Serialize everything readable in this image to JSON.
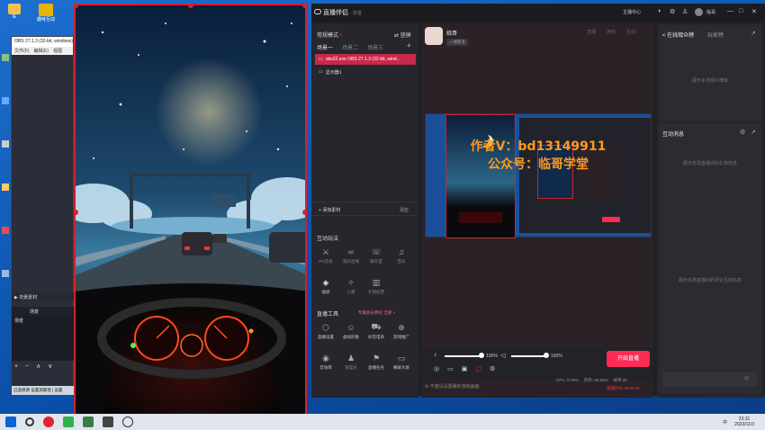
{
  "desktop": {
    "icons": [
      {
        "label": "IE",
        "color": "#f2c14e"
      },
      {
        "label": "趣味互动",
        "color": "#e8b400"
      }
    ]
  },
  "obs": {
    "title": "OBS 27.1.3 (32-bit, windows)",
    "menu": [
      "文件(F)",
      "编辑(E)",
      "视图"
    ],
    "panels": {
      "sources_label": "背景素材",
      "scenes_header": "场景",
      "scenes_item": "场景",
      "controls_label": "+ − ∧ ∨"
    },
    "status": [
      "已选择源",
      "设置源属性 | 设置"
    ]
  },
  "app": {
    "title": "直播伴侣",
    "subtitle": "· 抖音",
    "window_controls": [
      "主播中心",
      "临哥",
      "—",
      "□",
      "✕"
    ],
    "mode_label": "常规模式",
    "mode_toggle": "竖屏",
    "scene_tabs": [
      "场景一",
      "场景二",
      "场景三"
    ],
    "sources": [
      {
        "label": "obs32.exe OBS 27.1.3 (32-bit, wind...",
        "active": true
      },
      {
        "label": "显示器1",
        "active": false
      }
    ],
    "add_source": "+ 添加素材",
    "clear": "清空",
    "interactive_title": "互动玩法",
    "interactive_items": [
      "PK连线",
      "观众连线",
      "聊天室",
      "音乐",
      "福袋",
      "心愿",
      "礼物投票"
    ],
    "tools_title": "直播工具",
    "tools_promo": "专属会员特权 全部 >",
    "tools_items": [
      "直播设置",
      "虚拟形象",
      "抖音电商",
      "游戏推广",
      "音效库",
      "管理员",
      "直播任务",
      "横屏大屏"
    ],
    "streamer_name": "临哥",
    "streamer_sub": "一线新主",
    "preview_tabs": [
      "直播",
      "连线",
      "互动"
    ],
    "watermark_line1": "作者V：bd13149911",
    "watermark_line2": "公众号：临哥学堂",
    "mic_volume": "100%",
    "speaker_volume": "100%",
    "mic_level": 1.0,
    "speaker_level": 1.0,
    "start_button": "开始直播",
    "stats": [
      "CPU: 0.78%",
      "内存: 59.82%",
      "帧率:30"
    ],
    "stats_time": "直播时长 00:00:39",
    "feedback": "不建议设置播的游戏画面",
    "right": {
      "audience_tab": "< 在线观众榜",
      "rank_tab": "玩家榜",
      "audience_empty": "展示本场观众榜单",
      "interaction_title": "互动消息",
      "interaction_empty": "展示本场直播间的礼物信息",
      "interaction_empty2": "展示本场直播间的评论互动信息",
      "input_placeholder": ""
    }
  },
  "taskbar": {
    "time": "23:31",
    "date": "2023/11/3",
    "lang": "中"
  },
  "colors": {
    "accent": "#fe2c55",
    "frame": "#d3202f"
  }
}
